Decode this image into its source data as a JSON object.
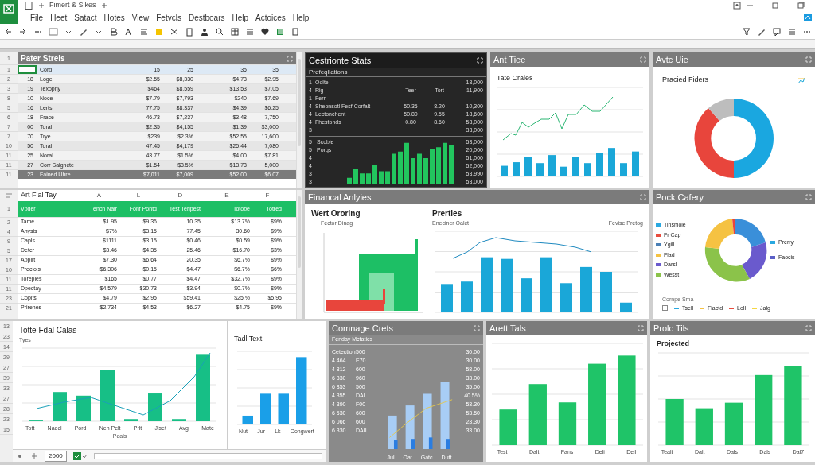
{
  "app": {
    "title": "Fimert & Sikes",
    "menu": [
      "File",
      "Heet",
      "Satact",
      "Hotes",
      "View",
      "Fetvcls",
      "Destboars",
      "Help",
      "Actoices",
      "Help"
    ]
  },
  "sheet1": {
    "header_row": "1",
    "title": "Pater Strels",
    "rows": [
      {
        "row": "1",
        "cells": [
          "",
          "Cord",
          "15",
          "25",
          "35",
          "35"
        ],
        "selected": true
      },
      {
        "row": "2",
        "cells": [
          "18",
          "Loge",
          "$2.55",
          "$8,330",
          "$4.73",
          "$2.95"
        ],
        "selected": false
      },
      {
        "row": "3",
        "cells": [
          "19",
          "Texophy",
          "$464",
          "$8,559",
          "$13.53",
          "$7.05"
        ],
        "selected": false
      },
      {
        "row": "8",
        "cells": [
          "10",
          "Noce",
          "$7.79",
          "$7,793",
          "$240",
          "$7.69"
        ],
        "selected": false
      },
      {
        "row": "5",
        "cells": [
          "16",
          "Lerts",
          "77.75",
          "$8,337",
          "$4.39",
          "$6.25"
        ],
        "selected": false
      },
      {
        "row": "6",
        "cells": [
          "18",
          "Frace",
          "46.73",
          "$7,237",
          "$3.48",
          "7,750"
        ],
        "selected": false
      },
      {
        "row": "7",
        "cells": [
          "00",
          "Toral",
          "$2.35",
          "$4,155",
          "$1.39",
          "$3,000"
        ],
        "selected": false
      },
      {
        "row": "7",
        "cells": [
          "70",
          "Trye",
          "$239",
          "$2.3%",
          "$52.55",
          "17,600"
        ],
        "selected": false
      },
      {
        "row": "10",
        "cells": [
          "50",
          "Toral",
          "47.45",
          "$4,179",
          "$25.44",
          "7,080"
        ],
        "selected": false
      },
      {
        "row": "11",
        "cells": [
          "25",
          "Noral",
          "43.77",
          "$1.5%",
          "$4.00",
          "$7.81"
        ],
        "selected": false
      },
      {
        "row": "11",
        "cells": [
          "27",
          "Corr Salgncte",
          "$1.54",
          "$3.5%",
          "$13.73",
          "5,000"
        ],
        "selected": false
      }
    ],
    "total": {
      "row": "11",
      "cells": [
        "23",
        "Fained Uhre",
        "$7,011",
        "$7,009",
        "$52.00",
        "$6.07"
      ]
    }
  },
  "stats": {
    "title": "Cestrionte Stats",
    "subtitle": "Prefeqllations",
    "rows": [
      [
        "1",
        "Oolte",
        "",
        "",
        "18,000"
      ],
      [
        "4",
        "Rig",
        "Teer",
        "Tort",
        "11,900"
      ],
      [
        "1",
        "Fern",
        "",
        "",
        ""
      ],
      [
        "4",
        "Sheonsotl Fesf Corfalt",
        "50.35",
        "8.20",
        "10,300"
      ],
      [
        "4",
        "Lectonchent",
        "50.80",
        "9.55",
        "18,600"
      ],
      [
        "4",
        "Fhestonds",
        "0.80",
        "8.60",
        "58,000"
      ],
      [
        "3",
        "",
        "",
        "",
        "33,000"
      ]
    ],
    "lower_rows": [
      [
        "5",
        "Scoble",
        "53,000"
      ],
      [
        "5",
        "Porgs",
        "20,000"
      ],
      [
        "4",
        "",
        "51,000"
      ],
      [
        "4",
        "",
        "52,000"
      ],
      [
        "3",
        "",
        "53,990"
      ],
      [
        "3",
        "",
        "53,000"
      ]
    ]
  },
  "line_panel": {
    "title": "Ant Tiee",
    "chart_title": "Tate Craies"
  },
  "donut_panel": {
    "title": "Avtc Uie",
    "chart_title": "Pracied Fiders"
  },
  "sheet2": {
    "corner": "Art Fial Tay",
    "letters": [
      "A",
      "L",
      "D",
      "E",
      "F"
    ],
    "header_row": "1",
    "headers": [
      "Vpder",
      "Tench Nair",
      "Fonf Pontd",
      "Test Teripest",
      "Totobe",
      "Totred"
    ],
    "rows": [
      {
        "row": "2",
        "cells": [
          "Tame",
          "$1.95",
          "$9.36",
          "10.35",
          "$13.7%",
          "$9%"
        ]
      },
      {
        "row": "4",
        "cells": [
          "Anysis",
          "$7%",
          "$3.15",
          "77.45",
          "30.60",
          "$9%"
        ]
      },
      {
        "row": "9",
        "cells": [
          "Capls",
          "$1111",
          "$3.15",
          "$0.46",
          "$0.59",
          "$9%"
        ]
      },
      {
        "row": "5",
        "cells": [
          "Deter",
          "$3.46",
          "$4.35",
          "25.46",
          "$16.70",
          "$3%"
        ]
      },
      {
        "row": "17",
        "cells": [
          "Appirt",
          "$7.30",
          "$6.64",
          "20.35",
          "$6.7%",
          "$9%"
        ]
      },
      {
        "row": "10",
        "cells": [
          "Preciols",
          "$6,306",
          "$0.15",
          "$4.47",
          "$6.7%",
          "$6%"
        ]
      },
      {
        "row": "11",
        "cells": [
          "Torepies",
          "$165",
          "$0.77",
          "$4.47",
          "$32.7%",
          "$9%"
        ]
      },
      {
        "row": "11",
        "cells": [
          "Dpectay",
          "$4,579",
          "$30.73",
          "$3.94",
          "$0.7%",
          "$9%"
        ]
      },
      {
        "row": "23",
        "cells": [
          "Copits",
          "$4.79",
          "$2.95",
          "$59.41",
          "$25.%",
          "$5.95"
        ]
      },
      {
        "row": "21",
        "cells": [
          "Prirenes",
          "$2,734",
          "$4.53",
          "$6.27",
          "$4.75",
          "$9%"
        ]
      }
    ]
  },
  "financial": {
    "title": "Financal Anlyies",
    "left_title": "Wert Ororing",
    "left_subtitle": "Fector Dinag",
    "right_title": "Prerties",
    "right_subtitle": "Eneciner Oalct",
    "right_axis": "Fevise Pretog"
  },
  "category": {
    "title": "Pock Cafery",
    "legend": [
      {
        "label": "Tinshiole",
        "color": "#29a8e0"
      },
      {
        "label": "Fr Cap",
        "color": "#e84c3d"
      },
      {
        "label": "Ygill",
        "color": "#4a7fb5"
      },
      {
        "label": "Flad",
        "color": "#f5c242"
      },
      {
        "label": "Darsl",
        "color": "#6a5acd"
      },
      {
        "label": "Wesst",
        "color": "#8bc34a"
      }
    ],
    "side_legend": [
      {
        "label": "Prerry",
        "color": "#29a8e0"
      },
      {
        "label": "Faocis",
        "color": "#5b5fc7"
      }
    ],
    "bottom_title": "Cornpe Sma",
    "bottom_legend": [
      {
        "label": "Tsell",
        "color": "#29a8e0"
      },
      {
        "label": "Flactd",
        "color": "#f5c242"
      },
      {
        "label": "Loll",
        "color": "#e84c3d"
      },
      {
        "label": "Jalg",
        "color": "#f5d742"
      }
    ]
  },
  "totals": {
    "row_numbers": [
      "13",
      "23",
      "14",
      "29",
      "27",
      "39",
      "33",
      "27",
      "28",
      "23",
      "15"
    ],
    "title": "Totte Fdal Calas",
    "ylabel": "Tyes",
    "xlabels": [
      "Tott",
      "Naecl",
      "Pord",
      "Nen Pelt",
      "Prlt",
      "Jiset",
      "Avg",
      "Mate"
    ],
    "xlabel": "Peals",
    "side_title": "Tadl Text",
    "side_xlabels": [
      "Nut",
      "Jur",
      "Lk",
      "Congwert"
    ],
    "cell_value": "2000"
  },
  "compare": {
    "title": "Comnage Crets",
    "subtitle": "Fenday Mctaties",
    "rows": [
      [
        "Cetection",
        "500",
        "30.00"
      ],
      [
        "4 464",
        "E70",
        "30.00"
      ],
      [
        "4 812",
        "600",
        "58.00"
      ],
      [
        "6 330",
        "960",
        "33.00"
      ],
      [
        "6 853",
        "500",
        "35.00"
      ],
      [
        "4 355",
        "DAI",
        "40.5%"
      ],
      [
        "4 390",
        "F00",
        "53.30"
      ],
      [
        "6 530",
        "600",
        "53.50"
      ],
      [
        "6 066",
        "600",
        "23.30"
      ],
      [
        "6 330",
        "DAII",
        "33.00"
      ]
    ],
    "xlabels": [
      "Jul",
      "Oat",
      "Gatc",
      "Dutt"
    ]
  },
  "arett": {
    "title": "Arett Tals",
    "xlabels": [
      "Test",
      "Dalt",
      "Fans",
      "Deli",
      "Dell"
    ]
  },
  "projected": {
    "title": "Prolc Tils",
    "subtitle": "Projected",
    "xlabels": [
      "Tealt",
      "Dalt",
      "Dals",
      "Dals",
      "Dal7"
    ]
  }
}
